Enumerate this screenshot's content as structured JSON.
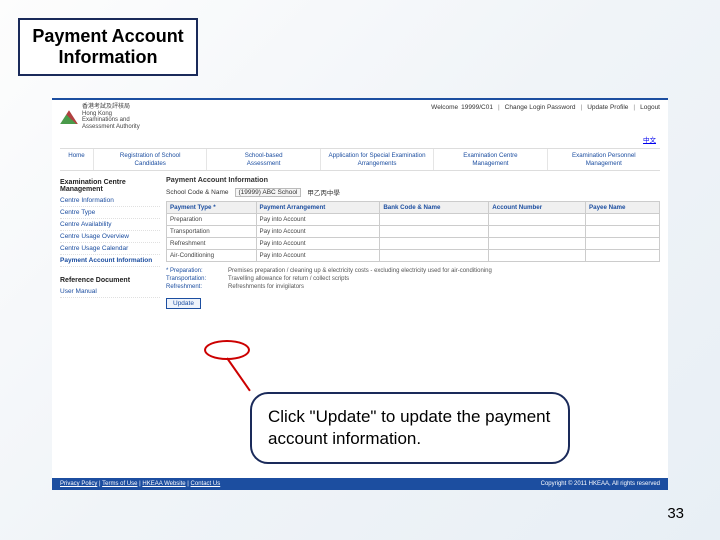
{
  "slide": {
    "title": "Payment Account Information",
    "instruction": "Click \"Update\" to update the payment account information.",
    "page_number": "33"
  },
  "header": {
    "org_name_zh": "香港考試及評核局",
    "org_name_en1": "Hong Kong",
    "org_name_en2": "Examinations and",
    "org_name_en3": "Assessment Authority",
    "welcome_prefix": "Welcome",
    "user_id": "19999/C01",
    "change_pw": "Change Login Password",
    "update_profile": "Update Profile",
    "logout": "Logout",
    "lang": "中文"
  },
  "nav": {
    "home": "Home",
    "tab1a": "Registration of School",
    "tab1b": "Candidates",
    "tab2a": "School-based",
    "tab2b": "Assessment",
    "tab3a": "Application for Special Examination",
    "tab3b": "Arrangements",
    "tab4a": "Examination Centre",
    "tab4b": "Management",
    "tab5a": "Examination Personnel",
    "tab5b": "Management"
  },
  "sidebar": {
    "section1": "Examination Centre Management",
    "items": [
      "Centre Information",
      "Centre Type",
      "Centre Availability",
      "Centre Usage Overview",
      "Centre Usage Calendar",
      "Payment Account Information"
    ],
    "section2": "Reference Document",
    "ref_item": "User Manual"
  },
  "main": {
    "page_title": "Payment Account Information",
    "label_school": "School Code & Name",
    "school_code": "(19999)   ABC School",
    "school_zh": "甲乙丙中學",
    "th1": "Payment Type *",
    "th2": "Payment Arrangement",
    "th3": "Bank Code & Name",
    "th4": "Account Number",
    "th5": "Payee Name",
    "rows": [
      {
        "c1": "Preparation",
        "c2": "Pay into Account"
      },
      {
        "c1": "Transportation",
        "c2": "Pay into Account"
      },
      {
        "c1": "Refreshment",
        "c2": "Pay into Account"
      },
      {
        "c1": "Air-Conditioning",
        "c2": "Pay into Account"
      }
    ],
    "notes_label1": "* Preparation:",
    "notes_text1": "Premises preparation / cleaning up & electricity costs - excluding electricity used for air-conditioning",
    "notes_label2": "Transportation:",
    "notes_text2": "Travelling allowance for return / collect scripts",
    "notes_label3": "Refreshment:",
    "notes_text3": "Refreshments for invigilators",
    "update_btn": "Update"
  },
  "footer": {
    "l1": "Privacy Policy",
    "l2": "Terms of Use",
    "l3": "HKEAA Website",
    "l4": "Contact Us",
    "copy": "Copyright © 2011 HKEAA, All rights reserved"
  }
}
